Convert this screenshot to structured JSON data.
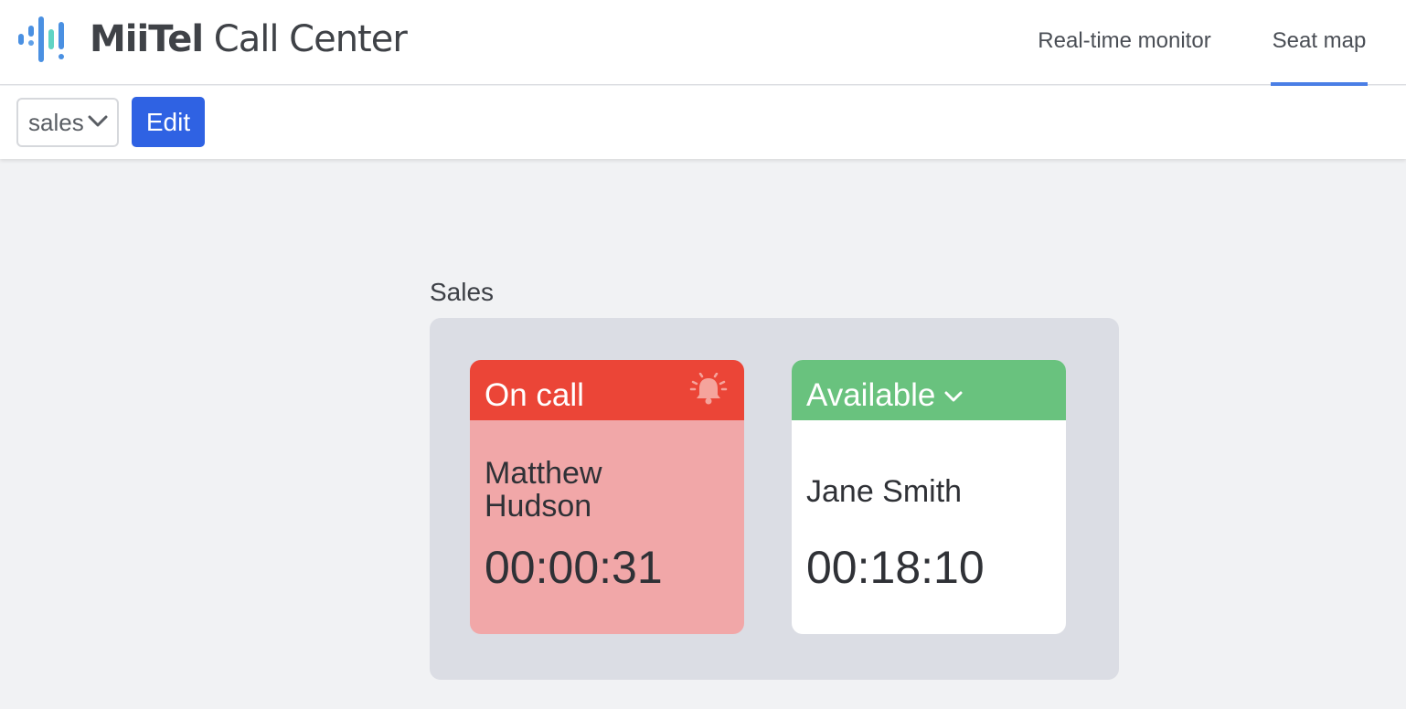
{
  "app": {
    "logo_brand": "MiiTel",
    "logo_product": "Call Center",
    "brand_colors": [
      "#4a90e2",
      "#5fd4c4"
    ]
  },
  "nav": {
    "tabs": [
      {
        "label": "Real-time monitor",
        "active": false
      },
      {
        "label": "Seat map",
        "active": true
      }
    ],
    "active_color": "#4a7fe6"
  },
  "toolbar": {
    "group_select": {
      "value": "sales",
      "icon": "chevron-down-icon"
    },
    "edit_label": "Edit",
    "edit_color": "#2f62e3"
  },
  "seat_map": {
    "group_title": "Sales",
    "seats": [
      {
        "status": "On call",
        "status_color": "#eb4537",
        "body_color": "#f1a7a8",
        "icon": "bell-ringing-icon",
        "agent_name": "Matthew Hudson",
        "timer": "00:00:31"
      },
      {
        "status": "Available",
        "status_color": "#69c27e",
        "body_color": "#ffffff",
        "icon": "chevron-down-icon",
        "agent_name": "Jane Smith",
        "timer": "00:18:10"
      }
    ]
  }
}
